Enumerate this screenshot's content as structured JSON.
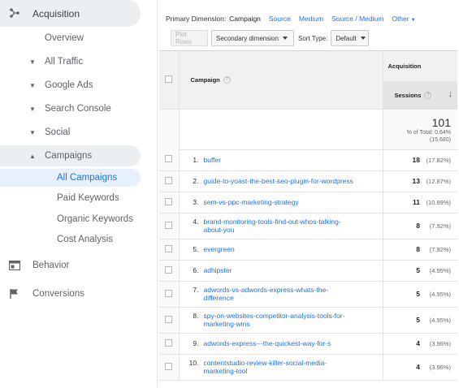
{
  "sidebar": {
    "acquisition": "Acquisition",
    "overview": "Overview",
    "all_traffic": "All Traffic",
    "google_ads": "Google Ads",
    "search_console": "Search Console",
    "social": "Social",
    "campaigns": "Campaigns",
    "all_campaigns": "All Campaigns",
    "paid_keywords": "Paid Keywords",
    "organic_keywords": "Organic Keywords",
    "cost_analysis": "Cost Analysis",
    "behavior": "Behavior",
    "conversions": "Conversions"
  },
  "dimension_bar": {
    "label": "Primary Dimension:",
    "active": "Campaign",
    "options": [
      "Source",
      "Medium",
      "Source / Medium",
      "Other"
    ]
  },
  "toolbar": {
    "plot_rows": "Plot Rows",
    "secondary_dimension": "Secondary dimension",
    "sort_type_label": "Sort Type:",
    "sort_type_value": "Default"
  },
  "table": {
    "group_header": "Acquisition",
    "campaign_header": "Campaign",
    "sessions_header": "Sessions",
    "total_value": "101",
    "total_pct_line1": "% of Total: 0.64%",
    "total_pct_line2": "(15,680)",
    "rows": [
      {
        "num": "1.",
        "line1": "buffer",
        "line2": "",
        "sessions": "18",
        "pct": "(17.82%)"
      },
      {
        "num": "2.",
        "line1": "guide-to-yoast-the-best-seo-plugin-for-wordpress",
        "line2": "",
        "sessions": "13",
        "pct": "(12.87%)"
      },
      {
        "num": "3.",
        "line1": "sem-vs-ppc-marketing-strategy",
        "line2": "",
        "sessions": "11",
        "pct": "(10.89%)"
      },
      {
        "num": "4.",
        "line1": "brand-monitoring-tools-find-out-whos-talking-",
        "line2": "about-you",
        "sessions": "8",
        "pct": "(7.92%)"
      },
      {
        "num": "5.",
        "line1": "evergreen",
        "line2": "",
        "sessions": "8",
        "pct": "(7.92%)"
      },
      {
        "num": "6.",
        "line1": "adhipster",
        "line2": "",
        "sessions": "5",
        "pct": "(4.95%)"
      },
      {
        "num": "7.",
        "line1": "adwords-vs-adwords-express-whats-the-",
        "line2": "difference",
        "sessions": "5",
        "pct": "(4.95%)"
      },
      {
        "num": "8.",
        "line1": "spy-on-websites-competitor-analysis-tools-for-",
        "line2": "marketing-wins",
        "sessions": "5",
        "pct": "(4.95%)"
      },
      {
        "num": "9.",
        "line1": "adwords-express---the-quickest-way-for-s",
        "line2": "",
        "sessions": "4",
        "pct": "(3.96%)"
      },
      {
        "num": "10.",
        "line1": "contentstudio-review-killer-social-media-",
        "line2": "marketing-tool",
        "sessions": "4",
        "pct": "(3.96%)"
      }
    ]
  },
  "colors": {
    "link": "#1a73e8",
    "active_section_bg": "#eceff1",
    "selected_item_bg": "#e8f0fe"
  },
  "icons": [
    "acquisition-icon",
    "behavior-icon",
    "conversions-icon",
    "help-icon",
    "sort-arrow-icon"
  ]
}
